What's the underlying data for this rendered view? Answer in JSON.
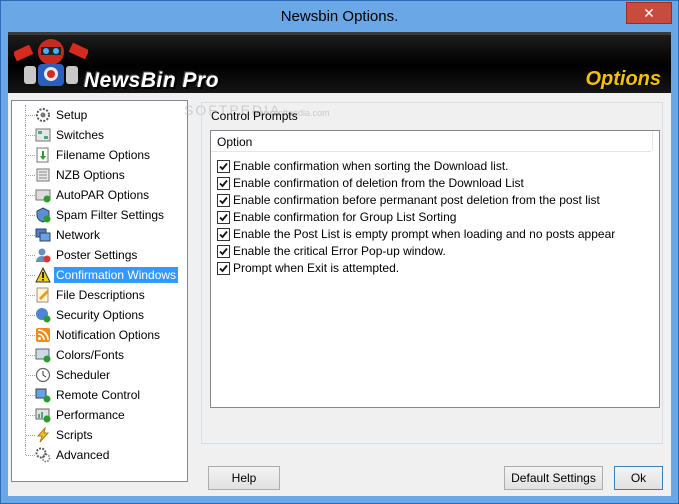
{
  "window": {
    "title": "Newsbin Options.",
    "close_glyph": "✕"
  },
  "banner": {
    "brand": "NewsBin Pro",
    "section": "Options"
  },
  "watermark": {
    "text": "SOFTPEDIA",
    "url": "www.softpedia.com"
  },
  "tree": {
    "items": [
      {
        "label": "Setup",
        "icon": "gear-icon"
      },
      {
        "label": "Switches",
        "icon": "switches-icon"
      },
      {
        "label": "Filename Options",
        "icon": "filename-icon"
      },
      {
        "label": "NZB Options",
        "icon": "nzb-icon"
      },
      {
        "label": "AutoPAR Options",
        "icon": "autopar-icon"
      },
      {
        "label": "Spam Filter Settings",
        "icon": "spam-filter-icon"
      },
      {
        "label": "Network",
        "icon": "network-icon"
      },
      {
        "label": "Poster Settings",
        "icon": "poster-icon"
      },
      {
        "label": "Confirmation Windows",
        "icon": "warning-icon"
      },
      {
        "label": "File Descriptions",
        "icon": "file-descriptions-icon"
      },
      {
        "label": "Security Options",
        "icon": "security-icon"
      },
      {
        "label": "Notification Options",
        "icon": "rss-icon"
      },
      {
        "label": "Colors/Fonts",
        "icon": "colors-fonts-icon"
      },
      {
        "label": "Scheduler",
        "icon": "clock-icon"
      },
      {
        "label": "Remote Control",
        "icon": "remote-control-icon"
      },
      {
        "label": "Performance",
        "icon": "performance-icon"
      },
      {
        "label": "Scripts",
        "icon": "lightning-icon"
      },
      {
        "label": "Advanced",
        "icon": "advanced-gear-icon"
      }
    ],
    "selected": "Confirmation Windows"
  },
  "panel": {
    "group_label": "Control Prompts",
    "column_header": "Option",
    "options": [
      {
        "label": "Enable confirmation when sorting the Download list.",
        "checked": true
      },
      {
        "label": "Enable confirmation of deletion from the Download List",
        "checked": true
      },
      {
        "label": "Enable confirmation before permanant post deletion from the post list",
        "checked": true
      },
      {
        "label": "Enable confirmation for Group List Sorting",
        "checked": true
      },
      {
        "label": "Enable the Post List is empty prompt when loading and no posts appear",
        "checked": true
      },
      {
        "label": "Enable the critical Error Pop-up window.",
        "checked": true
      },
      {
        "label": "Prompt when Exit is attempted.",
        "checked": true
      }
    ]
  },
  "buttons": {
    "help": "Help",
    "default_settings": "Default Settings",
    "ok": "Ok"
  },
  "colors": {
    "title_bar": "#6aa7e6",
    "selection": "#3399ff",
    "brand_accent": "#f5c000",
    "close_button": "#c74b3f"
  }
}
